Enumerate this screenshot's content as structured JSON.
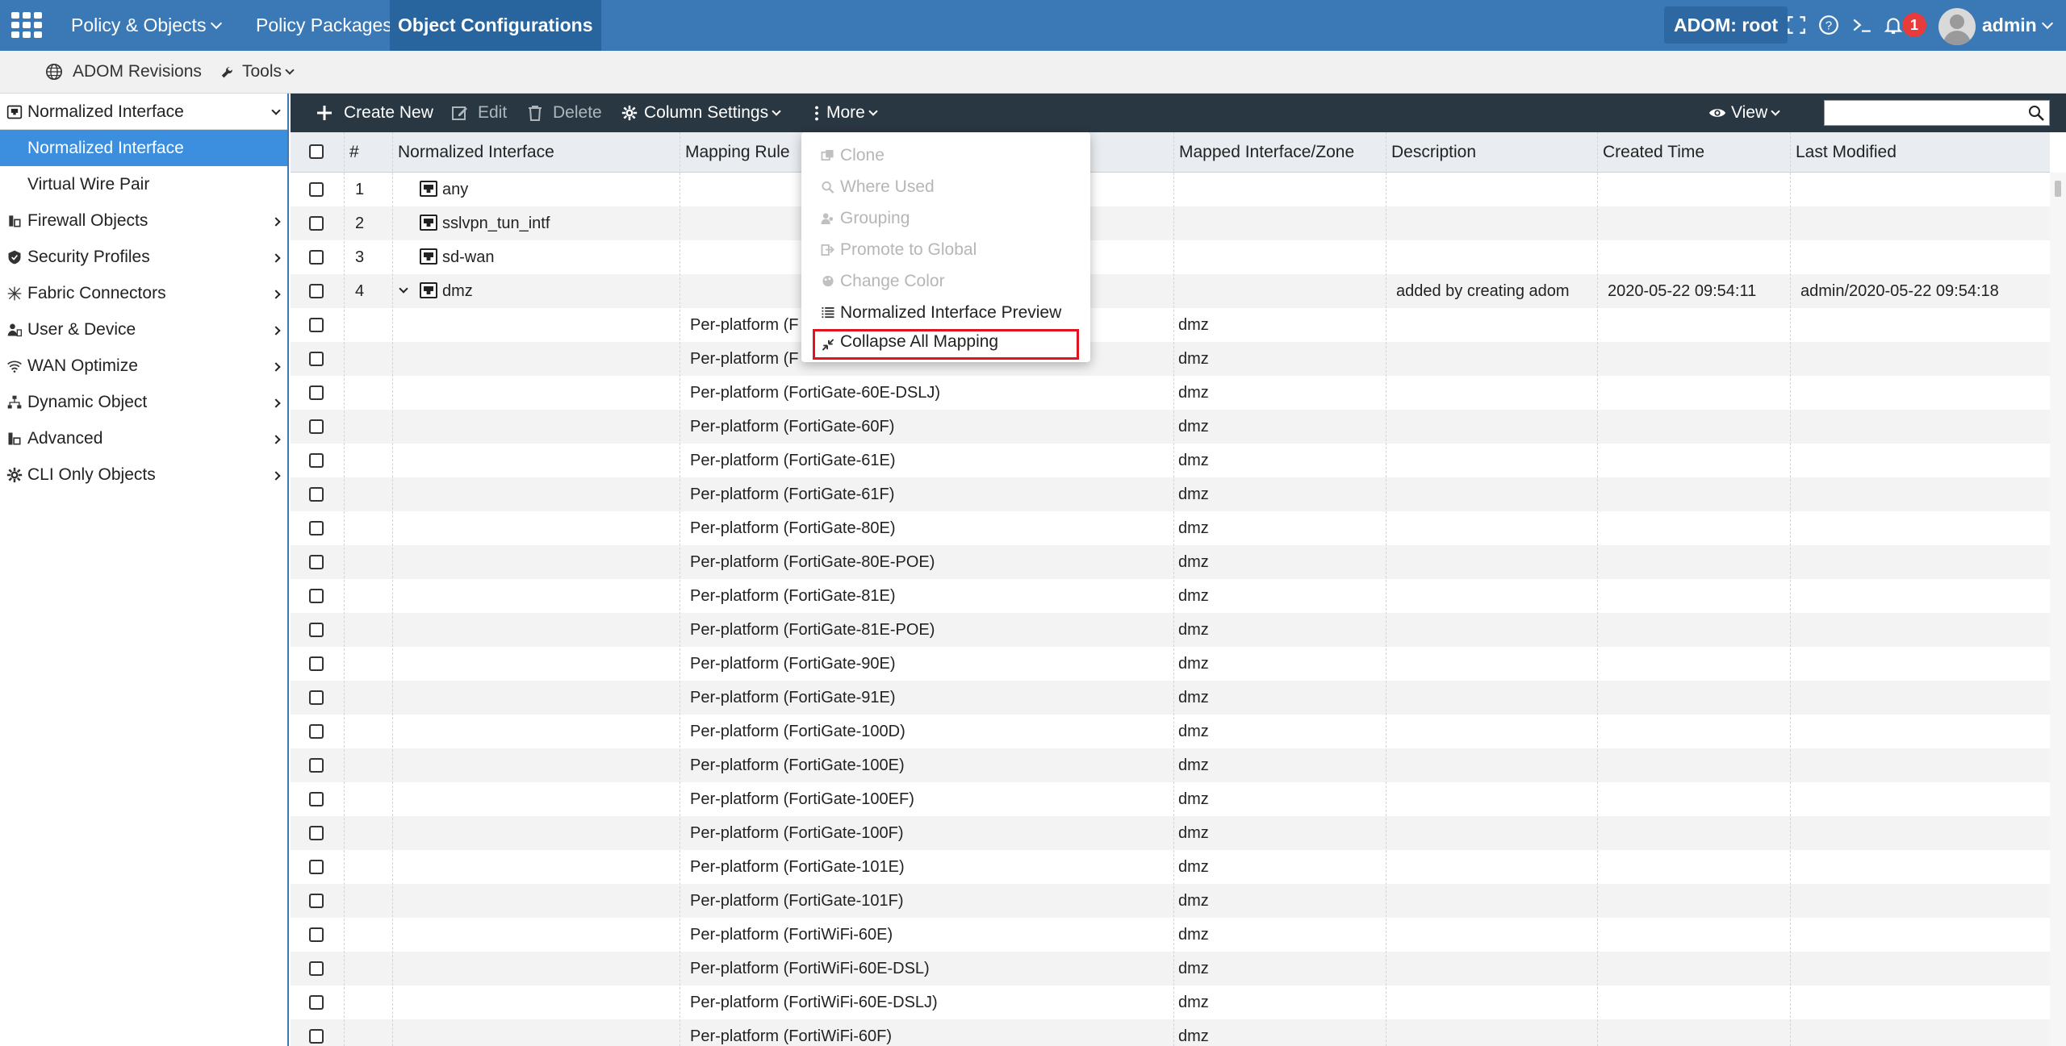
{
  "topbar": {
    "menus": [
      "Policy & Objects",
      "Policy Packages",
      "Object Configurations"
    ],
    "adom": "ADOM: root",
    "notification_count": "1",
    "user": "admin"
  },
  "subbar": {
    "adom_revisions": "ADOM Revisions",
    "tools": "Tools"
  },
  "sidebar": {
    "header": "Normalized Interface",
    "sub_items": [
      "Normalized Interface",
      "Virtual Wire Pair"
    ],
    "items": [
      "Firewall Objects",
      "Security Profiles",
      "Fabric Connectors",
      "User & Device",
      "WAN Optimize",
      "Dynamic Object",
      "Advanced",
      "CLI Only Objects"
    ]
  },
  "toolbar": {
    "create_new": "Create New",
    "edit": "Edit",
    "delete": "Delete",
    "column_settings": "Column Settings",
    "more": "More",
    "view": "View"
  },
  "table": {
    "headers": [
      "#",
      "Normalized Interface",
      "Mapping Rule",
      "Mapped Interface/Zone",
      "Description",
      "Created Time",
      "Last Modified"
    ],
    "interfaces": [
      {
        "num": "1",
        "name": "any"
      },
      {
        "num": "2",
        "name": "sslvpn_tun_intf"
      },
      {
        "num": "3",
        "name": "sd-wan"
      },
      {
        "num": "4",
        "name": "dmz",
        "description": "added by creating adom",
        "created": "2020-05-22 09:54:11",
        "modified": "admin/2020-05-22 09:54:18"
      }
    ],
    "mappings": [
      {
        "rule": "Per-platform (F",
        "zone": "dmz"
      },
      {
        "rule": "Per-platform (F",
        "zone": "dmz"
      },
      {
        "rule": "Per-platform (FortiGate-60E-DSLJ)",
        "zone": "dmz"
      },
      {
        "rule": "Per-platform (FortiGate-60F)",
        "zone": "dmz"
      },
      {
        "rule": "Per-platform (FortiGate-61E)",
        "zone": "dmz"
      },
      {
        "rule": "Per-platform (FortiGate-61F)",
        "zone": "dmz"
      },
      {
        "rule": "Per-platform (FortiGate-80E)",
        "zone": "dmz"
      },
      {
        "rule": "Per-platform (FortiGate-80E-POE)",
        "zone": "dmz"
      },
      {
        "rule": "Per-platform (FortiGate-81E)",
        "zone": "dmz"
      },
      {
        "rule": "Per-platform (FortiGate-81E-POE)",
        "zone": "dmz"
      },
      {
        "rule": "Per-platform (FortiGate-90E)",
        "zone": "dmz"
      },
      {
        "rule": "Per-platform (FortiGate-91E)",
        "zone": "dmz"
      },
      {
        "rule": "Per-platform (FortiGate-100D)",
        "zone": "dmz"
      },
      {
        "rule": "Per-platform (FortiGate-100E)",
        "zone": "dmz"
      },
      {
        "rule": "Per-platform (FortiGate-100EF)",
        "zone": "dmz"
      },
      {
        "rule": "Per-platform (FortiGate-100F)",
        "zone": "dmz"
      },
      {
        "rule": "Per-platform (FortiGate-101E)",
        "zone": "dmz"
      },
      {
        "rule": "Per-platform (FortiGate-101F)",
        "zone": "dmz"
      },
      {
        "rule": "Per-platform (FortiWiFi-60E)",
        "zone": "dmz"
      },
      {
        "rule": "Per-platform (FortiWiFi-60E-DSL)",
        "zone": "dmz"
      },
      {
        "rule": "Per-platform (FortiWiFi-60E-DSLJ)",
        "zone": "dmz"
      },
      {
        "rule": "Per-platform (FortiWiFi-60F)",
        "zone": "dmz"
      }
    ]
  },
  "more_menu": {
    "items": [
      {
        "label": "Clone",
        "icon": "clone-icon",
        "disabled": true
      },
      {
        "label": "Where Used",
        "icon": "search-icon",
        "disabled": true
      },
      {
        "label": "Grouping",
        "icon": "grouping-icon",
        "disabled": true
      },
      {
        "label": "Promote to Global",
        "icon": "promote-icon",
        "disabled": true
      },
      {
        "label": "Change Color",
        "icon": "palette-icon",
        "disabled": true
      },
      {
        "label": "Normalized Interface Preview",
        "icon": "list-icon",
        "disabled": false
      },
      {
        "label": "Collapse All Mapping",
        "icon": "collapse-icon",
        "disabled": false,
        "highlighted": true
      }
    ]
  },
  "colors": {
    "topbar": "#3b79b6",
    "toolbar": "#293742",
    "selected": "#3b8fde",
    "highlight_border": "#e0141e",
    "badge": "#e63c3c"
  }
}
